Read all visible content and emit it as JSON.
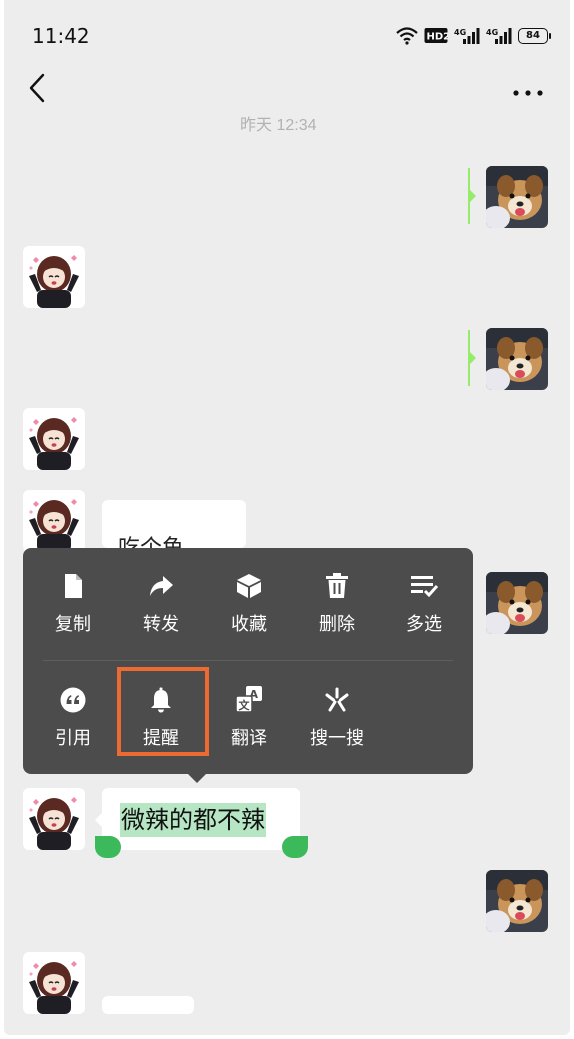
{
  "status_bar": {
    "time": "11:42",
    "battery": "84",
    "icons": [
      "wifi-icon",
      "hd2-icon",
      "signal-4g-icon",
      "signal-4g-icon"
    ],
    "hd_label": "HD2",
    "network_label": "4G"
  },
  "nav": {
    "back_icon": "chevron-left-icon",
    "more_icon": "more-dots-icon"
  },
  "chat": {
    "timestamp": "昨天 12:34",
    "selected_message": "微辣的都不辣",
    "partial_message_text": "吃个鱼"
  },
  "context_menu": {
    "row1": [
      {
        "label": "复制",
        "icon": "copy-icon"
      },
      {
        "label": "转发",
        "icon": "forward-icon"
      },
      {
        "label": "收藏",
        "icon": "favorite-box-icon"
      },
      {
        "label": "删除",
        "icon": "trash-icon"
      },
      {
        "label": "多选",
        "icon": "multi-select-icon"
      }
    ],
    "row2": [
      {
        "label": "引用",
        "icon": "quote-icon"
      },
      {
        "label": "提醒",
        "icon": "bell-icon"
      },
      {
        "label": "翻译",
        "icon": "translate-icon"
      },
      {
        "label": "搜一搜",
        "icon": "search-spark-icon"
      }
    ],
    "highlighted_item": "提醒"
  },
  "colors": {
    "background": "#ededed",
    "menu_bg": "#4c4c4c",
    "sent_bubble": "#95ec69",
    "selection": "#b6e6c4",
    "handle": "#3cb95b",
    "highlight_border": "#ee6a33"
  }
}
